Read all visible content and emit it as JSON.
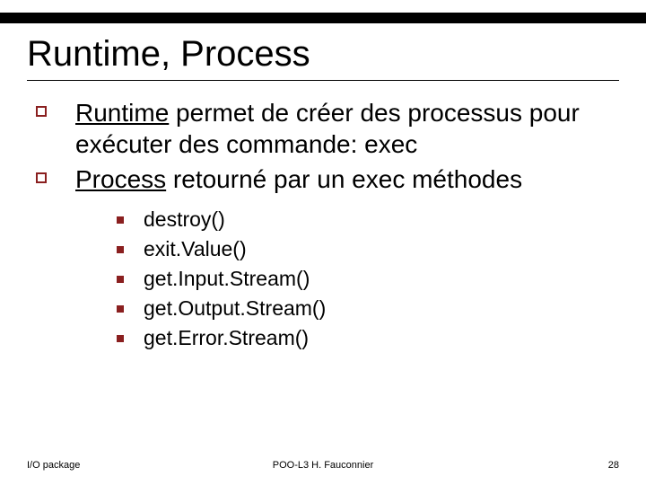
{
  "title": "Runtime, Process",
  "bullets": {
    "b0": {
      "link": "Runtime",
      "rest": " permet de créer des processus pour exécuter des commande: exec"
    },
    "b1": {
      "link": "Process",
      "rest": " retourné par un exec méthodes"
    }
  },
  "methods": {
    "m0": "destroy()",
    "m1": "exit.Value()",
    "m2": "get.Input.Stream()",
    "m3": "get.Output.Stream()",
    "m4": "get.Error.Stream()"
  },
  "footer": {
    "left": "I/O package",
    "center": "POO-L3 H. Fauconnier",
    "right": "28"
  }
}
